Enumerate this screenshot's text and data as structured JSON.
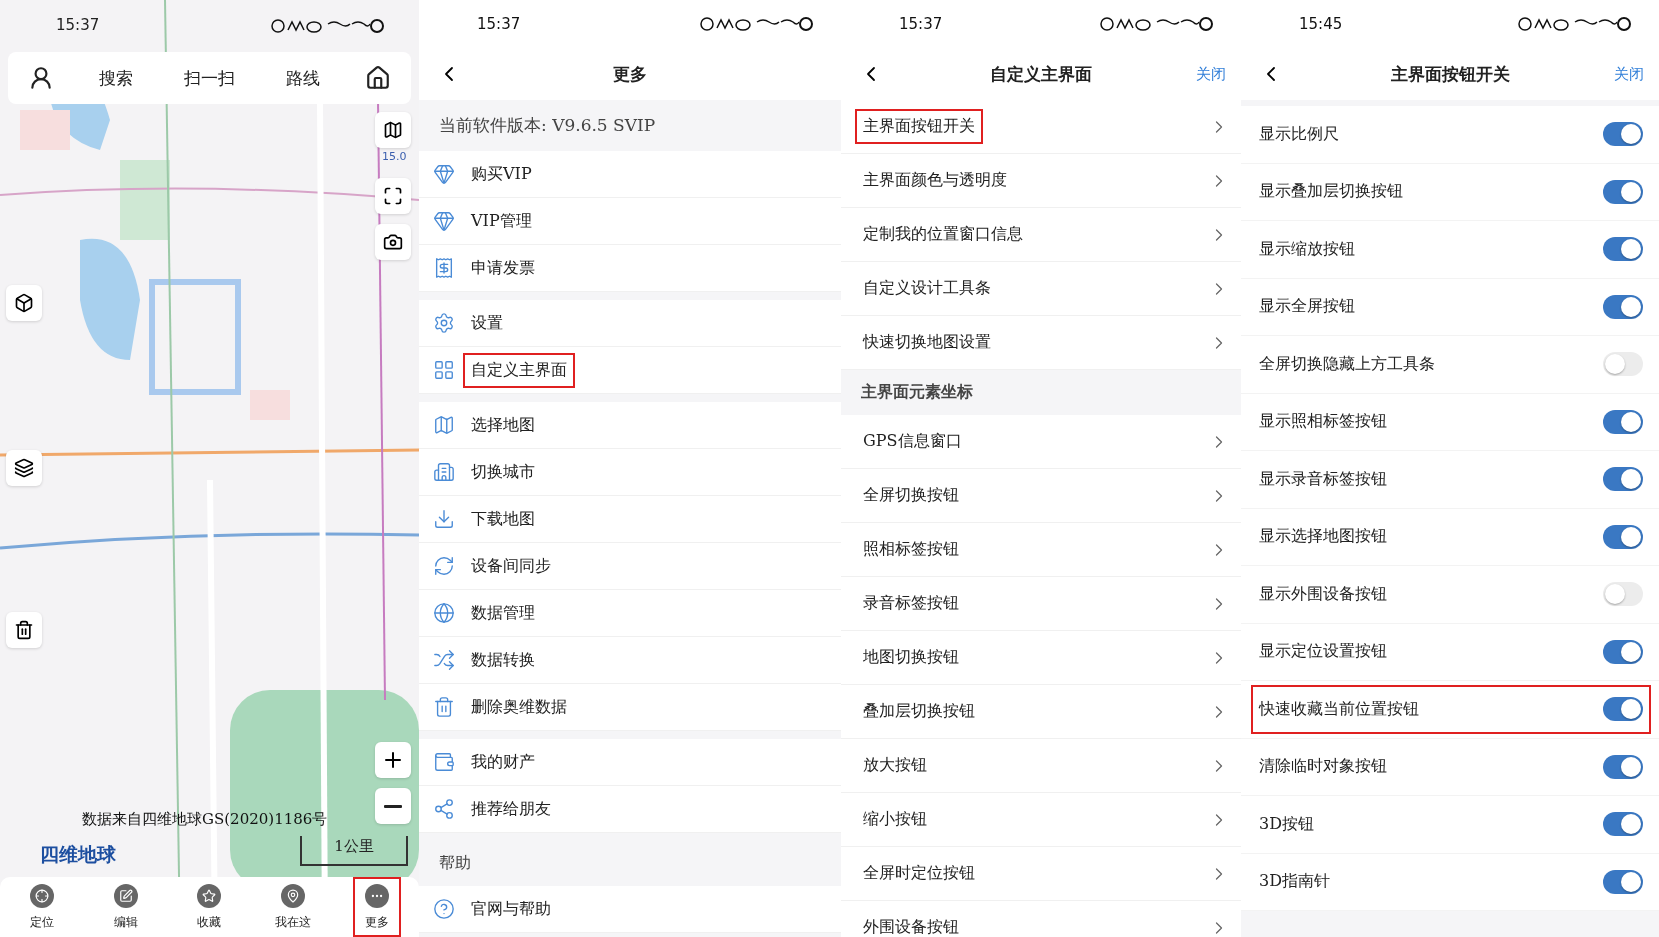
{
  "map_screen": {
    "time": "15:37",
    "toolbar": [
      "搜索",
      "扫一扫",
      "路线"
    ],
    "zoom_level": "15.0",
    "attribution": "数据来自四维地球GS(2020)1186号",
    "logo": "四维地球",
    "scale": "1公里",
    "nav": [
      {
        "label": "定位",
        "selected": false
      },
      {
        "label": "编辑",
        "selected": false
      },
      {
        "label": "收藏",
        "selected": false
      },
      {
        "label": "我在这",
        "selected": false
      },
      {
        "label": "更多",
        "selected": true
      }
    ]
  },
  "more_screen": {
    "time": "15:37",
    "title": "更多",
    "version": "当前软件版本: V9.6.5 SVIP",
    "groups": [
      {
        "items": [
          {
            "label": "购买VIP",
            "highlighted": false
          },
          {
            "label": "VIP管理",
            "highlighted": false
          },
          {
            "label": "申请发票",
            "highlighted": false
          }
        ]
      },
      {
        "items": [
          {
            "label": "设置",
            "highlighted": false
          },
          {
            "label": "自定义主界面",
            "highlighted": true
          }
        ]
      },
      {
        "items": [
          {
            "label": "选择地图",
            "highlighted": false
          },
          {
            "label": "切换城市",
            "highlighted": false
          },
          {
            "label": "下载地图",
            "highlighted": false
          },
          {
            "label": "设备间同步",
            "highlighted": false
          },
          {
            "label": "数据管理",
            "highlighted": false
          },
          {
            "label": "数据转换",
            "highlighted": false
          },
          {
            "label": "删除奥维数据",
            "highlighted": false
          }
        ]
      },
      {
        "items": [
          {
            "label": "我的财产",
            "highlighted": false
          },
          {
            "label": "推荐给朋友",
            "highlighted": false
          }
        ]
      },
      {
        "header": "帮助",
        "items": [
          {
            "label": "官网与帮助",
            "highlighted": false
          }
        ]
      }
    ]
  },
  "customize_screen": {
    "time": "15:37",
    "title": "自定义主界面",
    "close": "关闭",
    "groups": [
      {
        "items": [
          {
            "label": "主界面按钮开关",
            "highlighted": true
          },
          {
            "label": "主界面颜色与透明度",
            "highlighted": false
          },
          {
            "label": "定制我的位置窗口信息",
            "highlighted": false
          },
          {
            "label": "自定义设计工具条",
            "highlighted": false
          },
          {
            "label": "快速切换地图设置",
            "highlighted": false
          }
        ]
      },
      {
        "header": "主界面元素坐标",
        "items": [
          {
            "label": "GPS信息窗口",
            "highlighted": false
          },
          {
            "label": "全屏切换按钮",
            "highlighted": false
          },
          {
            "label": "照相标签按钮",
            "highlighted": false
          },
          {
            "label": "录音标签按钮",
            "highlighted": false
          },
          {
            "label": "地图切换按钮",
            "highlighted": false
          },
          {
            "label": "叠加层切换按钮",
            "highlighted": false
          },
          {
            "label": "放大按钮",
            "highlighted": false
          },
          {
            "label": "缩小按钮",
            "highlighted": false
          },
          {
            "label": "全屏时定位按钮",
            "highlighted": false
          },
          {
            "label": "外围设备按钮",
            "highlighted": false
          }
        ]
      }
    ]
  },
  "switches_screen": {
    "time": "15:45",
    "title": "主界面按钮开关",
    "close": "关闭",
    "items": [
      {
        "label": "显示比例尺",
        "on": true,
        "highlighted": false
      },
      {
        "label": "显示叠加层切换按钮",
        "on": true,
        "highlighted": false
      },
      {
        "label": "显示缩放按钮",
        "on": true,
        "highlighted": false
      },
      {
        "label": "显示全屏按钮",
        "on": true,
        "highlighted": false
      },
      {
        "label": "全屏切换隐藏上方工具条",
        "on": false,
        "highlighted": false
      },
      {
        "label": "显示照相标签按钮",
        "on": true,
        "highlighted": false
      },
      {
        "label": "显示录音标签按钮",
        "on": true,
        "highlighted": false
      },
      {
        "label": "显示选择地图按钮",
        "on": true,
        "highlighted": false
      },
      {
        "label": "显示外围设备按钮",
        "on": false,
        "highlighted": false
      },
      {
        "label": "显示定位设置按钮",
        "on": true,
        "highlighted": false
      },
      {
        "label": "快速收藏当前位置按钮",
        "on": true,
        "highlighted": true
      },
      {
        "label": "清除临时对象按钮",
        "on": true,
        "highlighted": false
      },
      {
        "label": "3D按钮",
        "on": true,
        "highlighted": false
      },
      {
        "label": "3D指南针",
        "on": true,
        "highlighted": false
      }
    ]
  }
}
